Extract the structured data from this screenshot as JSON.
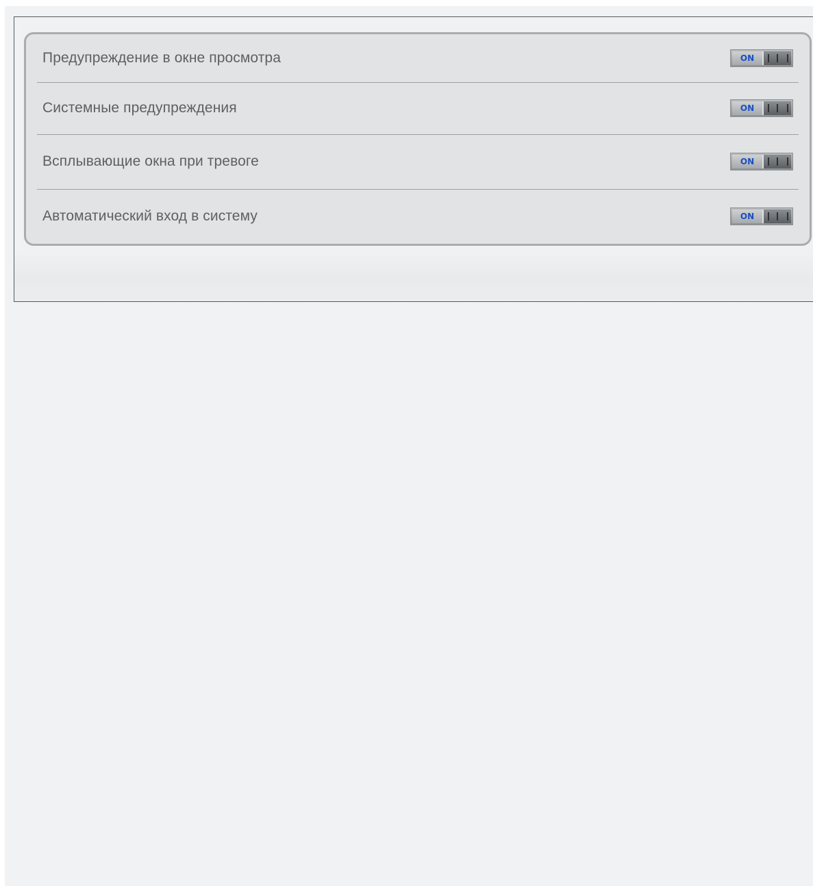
{
  "settings": {
    "items": [
      {
        "label": "Предупреждение в окне просмотра",
        "toggle_label": "ON",
        "enabled": true
      },
      {
        "label": "Системные предупреждения",
        "toggle_label": "ON",
        "enabled": true
      },
      {
        "label": "Всплывающие окна при тревоге",
        "toggle_label": "ON",
        "enabled": true
      },
      {
        "label": "Автоматический вход в систему",
        "toggle_label": "ON",
        "enabled": true
      }
    ]
  },
  "colors": {
    "toggle_on_text": "#1a4fc4",
    "label_text": "#5d6064",
    "box_border": "#a9acaf"
  }
}
